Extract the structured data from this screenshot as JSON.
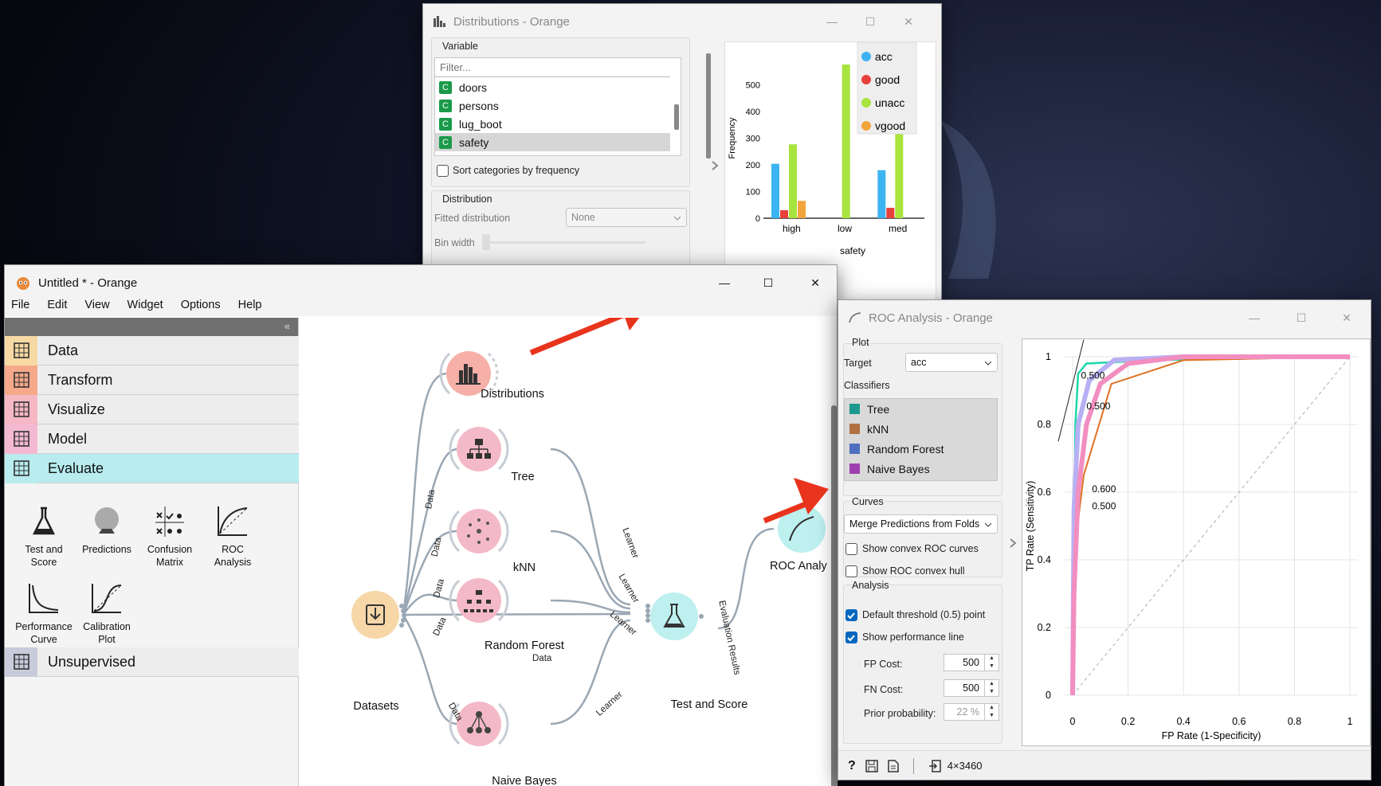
{
  "distributions": {
    "title": "Distributions - Orange",
    "variable_header": "Variable",
    "filter_placeholder": "Filter...",
    "variables": [
      "doors",
      "persons",
      "lug_boot",
      "safety"
    ],
    "var_type_glyph": "C",
    "sort_label": "Sort categories by frequency",
    "distribution_header": "Distribution",
    "fitted_label": "Fitted distribution",
    "fitted_value": "None",
    "bin_width_label": "Bin width"
  },
  "chart_data": {
    "type": "bar",
    "categories": [
      "high",
      "low",
      "med"
    ],
    "series": [
      {
        "name": "acc",
        "color": "#3db4f2",
        "values": [
          204,
          0,
          180
        ]
      },
      {
        "name": "good",
        "color": "#e8403d",
        "values": [
          30,
          0,
          39
        ]
      },
      {
        "name": "unacc",
        "color": "#a8e43d",
        "values": [
          277,
          576,
          357
        ]
      },
      {
        "name": "vgood",
        "color": "#f2a43d",
        "values": [
          65,
          0,
          0
        ]
      }
    ],
    "yticks": [
      "0",
      "100",
      "200",
      "300",
      "400",
      "500"
    ],
    "ylim": [
      0,
      600
    ],
    "ylabel": "Frequency",
    "xlabel": "safety",
    "legend_position": "top-right"
  },
  "main": {
    "title": "Untitled * - Orange",
    "menu": [
      "File",
      "Edit",
      "View",
      "Widget",
      "Options",
      "Help"
    ],
    "collapse_glyph": "«",
    "categories": [
      {
        "label": "Data",
        "color": "#f7d9a4"
      },
      {
        "label": "Transform",
        "color": "#f5a98a"
      },
      {
        "label": "Visualize",
        "color": "#f5b8c4"
      },
      {
        "label": "Model",
        "color": "#f3b9d2"
      },
      {
        "label": "Evaluate",
        "color": "#b8ecef"
      },
      {
        "label": "Unsupervised",
        "color": "#c7cbdb"
      }
    ],
    "evaluate_tools": [
      "Test and\nScore",
      "Predictions",
      "Confusion\nMatrix",
      "ROC\nAnalysis",
      "Performance\nCurve",
      "Calibration\nPlot"
    ],
    "nodes": {
      "distributions": "Distributions",
      "tree": "Tree",
      "knn": "kNN",
      "random_forest": "Random Forest",
      "naive_bayes": "Naive Bayes",
      "datasets": "Datasets",
      "test_and_score": "Test and Score",
      "roc": "ROC Analy"
    },
    "edge_labels": {
      "data": "Data",
      "learner": "Learner",
      "evaluation_results": "Evaluation Results"
    }
  },
  "roc": {
    "title": "ROC Analysis - Orange",
    "plot_header": "Plot",
    "target_label": "Target",
    "target_value": "acc",
    "classifiers_label": "Classifiers",
    "classifiers": [
      {
        "name": "Tree",
        "color": "#1a9a8f"
      },
      {
        "name": "kNN",
        "color": "#b07040"
      },
      {
        "name": "Random Forest",
        "color": "#4f6fc0"
      },
      {
        "name": "Naive Bayes",
        "color": "#a040b0"
      }
    ],
    "curves_header": "Curves",
    "curves_value": "Merge Predictions from Folds",
    "show_convex_curves": "Show convex ROC curves",
    "show_convex_hull": "Show ROC convex hull",
    "analysis_header": "Analysis",
    "default_threshold": "Default threshold (0.5) point",
    "show_perf_line": "Show performance line",
    "fp_cost_label": "FP Cost:",
    "fp_cost": "500",
    "fn_cost_label": "FN Cost:",
    "fn_cost": "500",
    "prior_label": "Prior probability:",
    "prior_value": "22 %",
    "status_size": "4×3460",
    "xlabel": "FP Rate (1-Specificity)",
    "ylabel": "TP Rate (Sensitivity)",
    "ticks": [
      "0",
      "0.2",
      "0.4",
      "0.6",
      "0.8",
      "1"
    ],
    "threshold_labels": [
      "0.500",
      "0.500",
      "0.600",
      "0.500"
    ]
  }
}
